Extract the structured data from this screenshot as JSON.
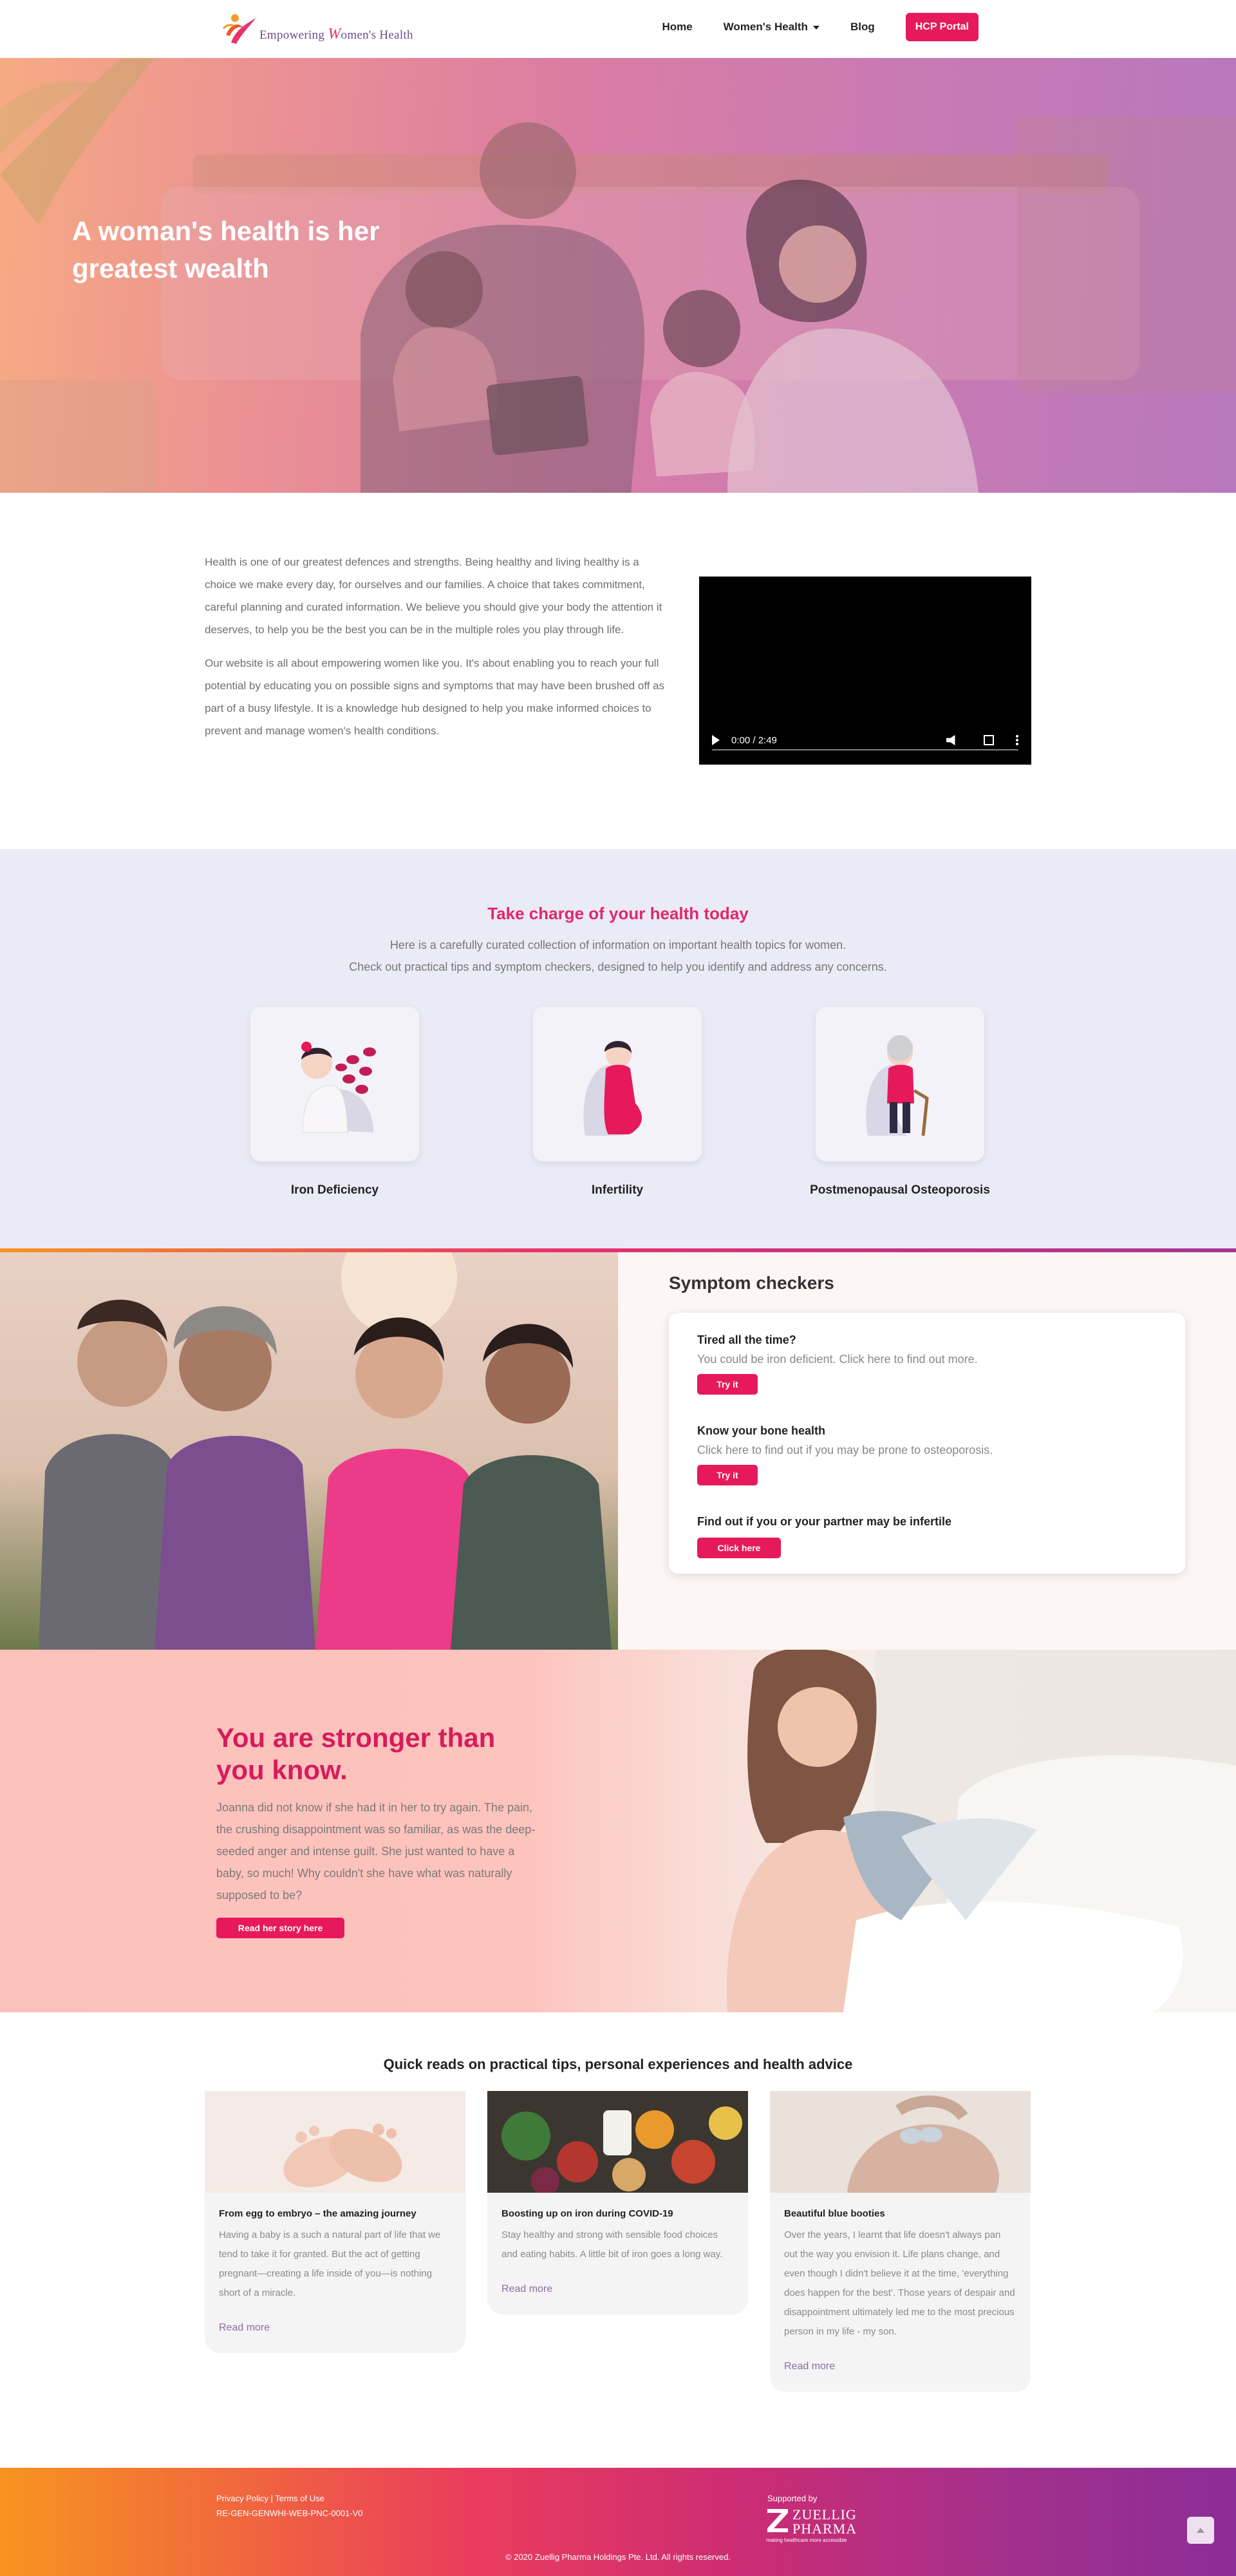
{
  "header": {
    "logo_prefix": "Empowering",
    "logo_w": "W",
    "logo_suffix": "omen's Health",
    "nav": {
      "home": "Home",
      "womens_health": "Women's Health",
      "blog": "Blog",
      "hcp_portal": "HCP Portal"
    }
  },
  "hero": {
    "title": "A woman's health is her greatest wealth"
  },
  "intro": {
    "paragraph_1": "Health is one of our greatest defences and strengths. Being healthy and living healthy is a choice we make every day, for ourselves and our families. A choice that takes commitment, careful planning and curated information. We believe you should give your body the attention it deserves, to help you be the best you can be in the multiple roles you play through life.",
    "paragraph_2": "Our website is all about empowering women like you. It's about enabling you to reach your full potential by educating you on possible signs and symptoms that may have been brushed off as part of a busy lifestyle. It is a knowledge hub designed to help you make informed choices to prevent and manage women's health conditions.",
    "video_time": "0:00 / 2:49"
  },
  "care": {
    "title": "Take charge of your health today",
    "subtitle_1": "Here is a carefully curated collection of information on important health topics for women.",
    "subtitle_2": "Check out practical tips and symptom checkers, designed to help you identify and address any concerns.",
    "topics": [
      {
        "label": "Iron Deficiency"
      },
      {
        "label": "Infertility"
      },
      {
        "label": "Postmenopausal Osteoporosis"
      }
    ]
  },
  "symptom": {
    "title": "Symptom checkers",
    "items": [
      {
        "question": "Tired all the time?",
        "desc": "You could be iron deficient. Click here to find out more.",
        "button": "Try it"
      },
      {
        "question": "Know your bone health",
        "desc": "Click here to find out if you may be prone to osteoporosis.",
        "button": "Try it"
      },
      {
        "question": "Find out if you or your partner may be infertile",
        "button": "Click here"
      }
    ]
  },
  "stronger": {
    "title": "You are stronger than you know.",
    "body": "Joanna did not know if she had it in her to try again. The pain, the crushing disappointment was so familiar, as was the deep-seeded anger and intense guilt. She just wanted to have a baby, so much! Why couldn't she have what was naturally supposed to be?",
    "button": "Read her story here"
  },
  "reads": {
    "title": "Quick reads on practical tips, personal experiences and health advice",
    "cards": [
      {
        "title": "From egg to embryo – the amazing journey",
        "text": "Having a baby is a such a natural part of life that we tend to take it for granted. But the act of getting pregnant—creating a life inside of you—is nothing short of a miracle.",
        "more": "Read more"
      },
      {
        "title": "Boosting up on iron during COVID-19",
        "text": "Stay healthy and strong with sensible food choices and eating habits. A little bit of iron goes a long way.",
        "more": "Read more"
      },
      {
        "title": "Beautiful blue booties",
        "text": "Over the years, I learnt that life doesn't always pan out the way you envision it. Life plans change, and even though I didn't believe it at the time, 'everything does happen for the best'. Those years of despair and disappointment ultimately led me to the most precious person in my life - my son.",
        "more": "Read more"
      }
    ]
  },
  "footer": {
    "links": "Privacy Policy | Terms of Use",
    "code": "RE-GEN-GENWHI-WEB-PNC-0001-V0",
    "supported_by": "Supported by",
    "sponsor_name_1": "ZUELLIG",
    "sponsor_name_2": "PHARMA",
    "sponsor_tagline": "making healthcare more accessible",
    "copyright": "© 2020 Zuellig Pharma Holdings Pte. Ltd. All rights reserved."
  },
  "colors": {
    "accent": "#e6195b",
    "heading_pink": "#e0296a",
    "care_bg": "#ebebf7",
    "symptom_bg": "#fdf6f4"
  }
}
